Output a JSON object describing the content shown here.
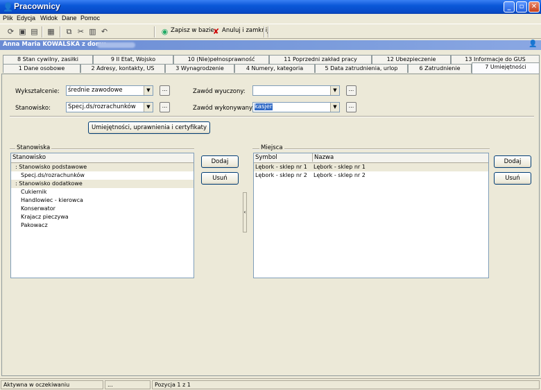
{
  "window": {
    "title": "Pracownicy"
  },
  "menu": [
    "Plik",
    "Edycja",
    "Widok",
    "Dane",
    "Pomoc"
  ],
  "toolbar": {
    "save_label": "Zapisz w bazie",
    "cancel_label": "Anuluj i zamknij"
  },
  "header": {
    "name": "Anna Maria KOWALSKA z domu"
  },
  "tabs_top": [
    "8 Stan cywilny, zasiłki",
    "9 II Etat, Wojsko",
    "10 (Nie)pełnosprawność",
    "11 Poprzedni zakład pracy",
    "12 Ubezpieczenie",
    "13 Informacje do GUS"
  ],
  "tabs_bottom": [
    "1 Dane osobowe",
    "2 Adresy, kontakty, US",
    "3 Wynagrodzenie",
    "4 Numery, kategoria",
    "5 Data zatrudnienia, urlop",
    "6 Zatrudnienie",
    "7 Umiejętności"
  ],
  "form": {
    "education_label": "Wykształcenie:",
    "education_value": "średnie zawodowe",
    "position_label": "Stanowisko:",
    "position_value": "Specj.ds/rozrachunków",
    "learned_label": "Zawód wyuczony:",
    "learned_value": "",
    "performed_label": "Zawód wykonywany:",
    "performed_value": "kasjer",
    "dots": "...",
    "skills_button": "Umiejętności, uprawnienia i certyfikaty"
  },
  "positions": {
    "group_label": "Stanowiska",
    "column": "Stanowisko",
    "rows": [
      ": Stanowisko podstawowe",
      "Specj.ds/rozrachunków",
      ": Stanowisko dodatkowe",
      "Cukiernik",
      "Handlowiec - kierowca",
      "Konserwator",
      "Krajacz pieczywa",
      "Pakowacz"
    ],
    "add": "Dodaj",
    "remove": "Usuń"
  },
  "places": {
    "group_label": "Miejsca",
    "columns": [
      "Symbol",
      "Nazwa"
    ],
    "rows": [
      [
        "Lębork - sklep nr 1",
        "Lębork - sklep nr 1"
      ],
      [
        "Lębork - sklep nr 2",
        "Lębork - sklep nr 2"
      ]
    ],
    "add": "Dodaj",
    "remove": "Usuń"
  },
  "status": {
    "state": "Aktywna w oczekiwaniu",
    "dots": "...",
    "position": "Pozycja 1 z 1"
  },
  "colors": {
    "titlebar": "#0b58d8",
    "selection": "#316ac5",
    "header": "#7b9cdc"
  }
}
